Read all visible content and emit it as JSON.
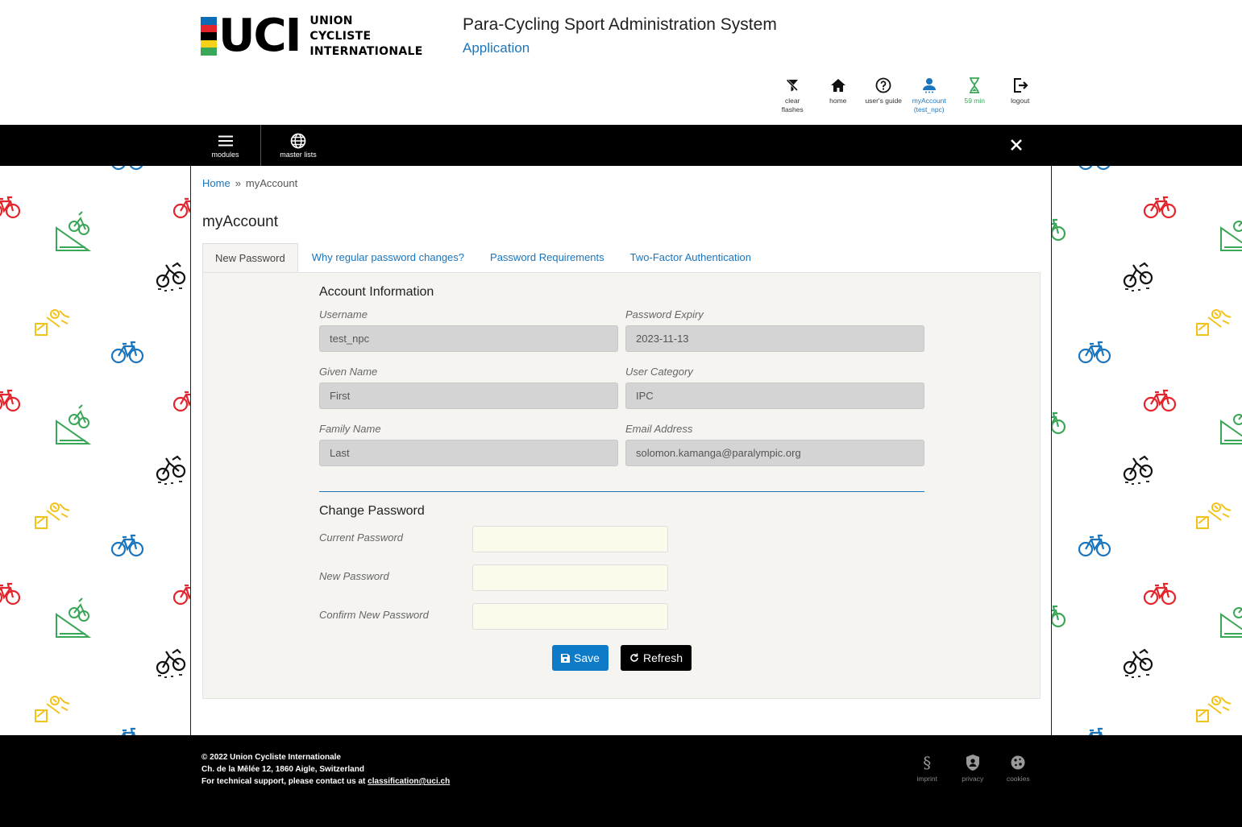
{
  "header": {
    "logo_letters": "UCI",
    "logo_text_line1": "UNION",
    "logo_text_line2": "CYCLISTE",
    "logo_text_line3": "INTERNATIONALE",
    "system_title": "Para-Cycling Sport Administration System",
    "system_subtitle": "Application"
  },
  "toolbar": {
    "clear_line1": "clear",
    "clear_line2": "flashes",
    "home": "home",
    "guide": "user's guide",
    "account_line1": "myAccount",
    "account_line2": "(test_npc)",
    "timer": "59 min",
    "logout": "logout"
  },
  "nav": {
    "modules": "modules",
    "master_lists": "master lists"
  },
  "breadcrumb": {
    "home": "Home",
    "separator": "»",
    "current": "myAccount"
  },
  "page_title": "myAccount",
  "tabs": [
    {
      "label": "New Password",
      "active": true
    },
    {
      "label": "Why regular password changes?",
      "active": false
    },
    {
      "label": "Password Requirements",
      "active": false
    },
    {
      "label": "Two-Factor Authentication",
      "active": false
    }
  ],
  "account_info": {
    "title": "Account Information",
    "username_label": "Username",
    "username_value": "test_npc",
    "expiry_label": "Password Expiry",
    "expiry_value": "2023-11-13",
    "given_label": "Given Name",
    "given_value": "First",
    "category_label": "User Category",
    "category_value": "IPC",
    "family_label": "Family Name",
    "family_value": "Last",
    "email_label": "Email Address",
    "email_value": "solomon.kamanga@paralympic.org"
  },
  "change_password": {
    "title": "Change Password",
    "current_label": "Current Password",
    "new_label": "New Password",
    "confirm_label": "Confirm New Password",
    "current_value": "",
    "new_value": "",
    "confirm_value": ""
  },
  "buttons": {
    "save": "Save",
    "refresh": "Refresh"
  },
  "footer": {
    "line1": "© 2022 Union Cycliste Internationale",
    "line2": "Ch. de la Mêlée 12, 1860 Aigle, Switzerland",
    "line3_prefix": "For technical support, please contact us at ",
    "line3_email": "classification@uci.ch",
    "imprint": "imprint",
    "privacy": "privacy",
    "cookies": "cookies"
  },
  "colors": {
    "accent": "#1b75bc",
    "save_button": "#0e7bc9",
    "timer_green": "#3aa657",
    "bar_black": "#000000",
    "panel_bg": "#f5f4f0",
    "readonly_bg": "#d4d4d4",
    "password_bg": "#fbfbec",
    "uci_blue": "#0a6cb5",
    "uci_red": "#e3242b",
    "uci_yellow": "#f7d117",
    "uci_green": "#3aa657"
  }
}
